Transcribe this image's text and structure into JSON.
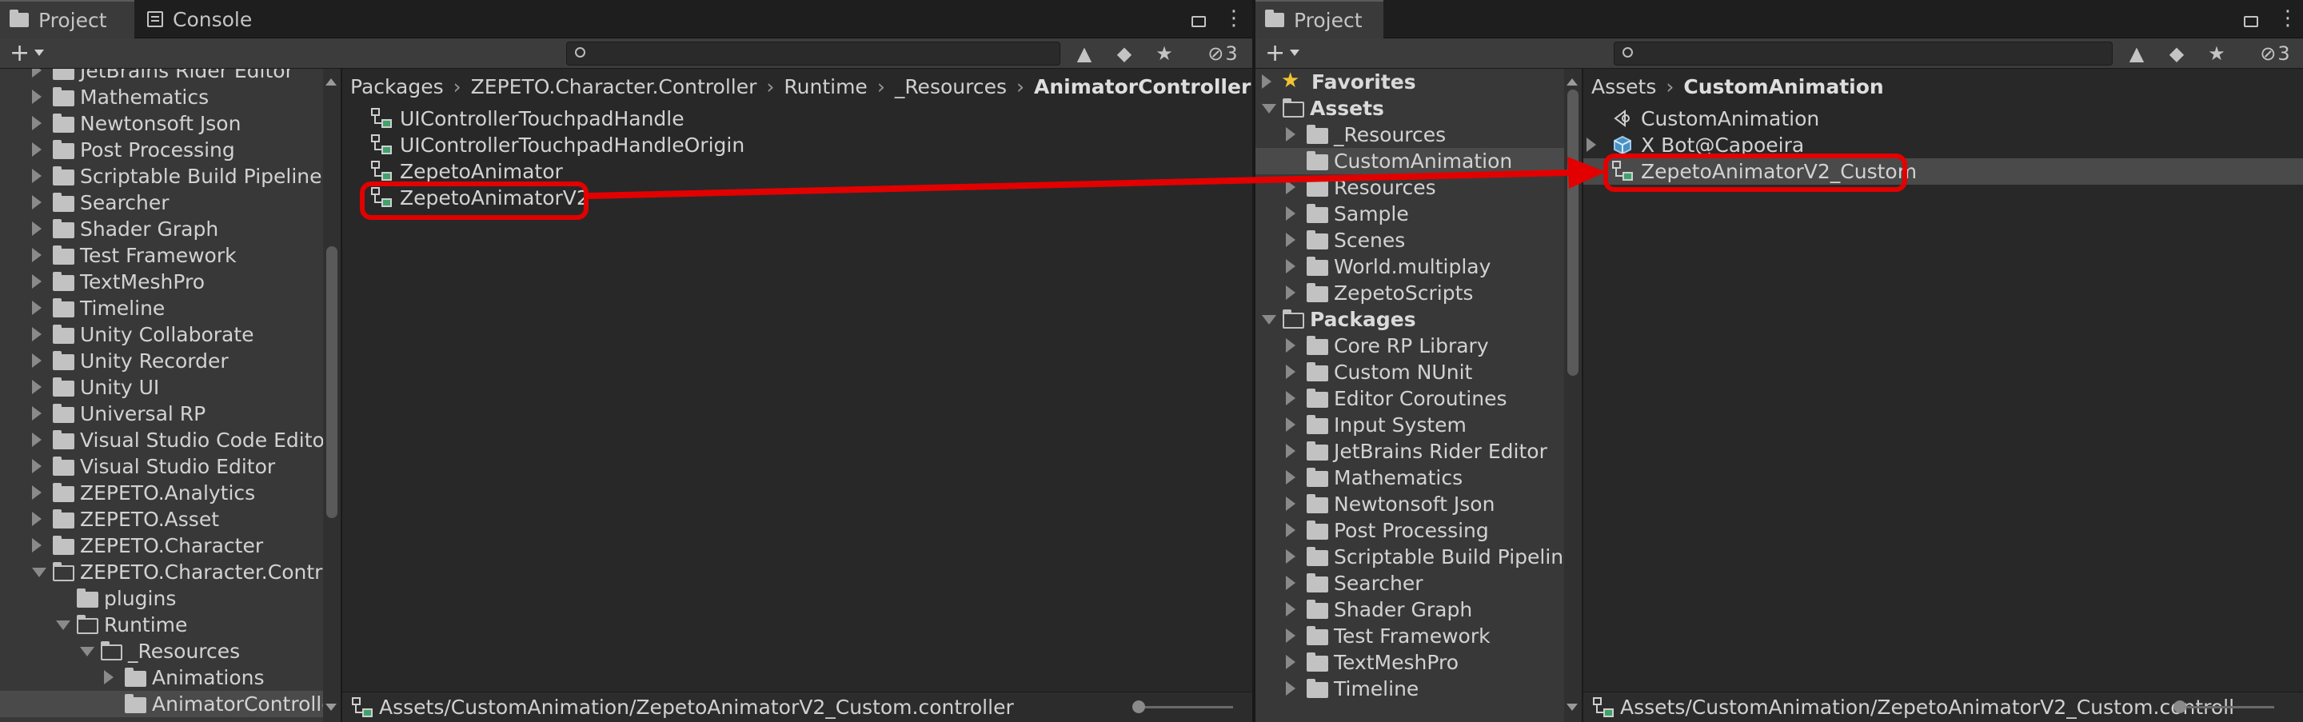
{
  "left_window": {
    "tabs": [
      "Project",
      "Console"
    ],
    "toolbar": {
      "add_label": "+",
      "hidden_count": "3"
    },
    "tree_items": [
      {
        "label": "JetBrains Rider Editor",
        "expanded": false
      },
      {
        "label": "Mathematics",
        "expanded": false
      },
      {
        "label": "Newtonsoft Json",
        "expanded": false
      },
      {
        "label": "Post Processing",
        "expanded": false
      },
      {
        "label": "Scriptable Build Pipeline",
        "expanded": false
      },
      {
        "label": "Searcher",
        "expanded": false
      },
      {
        "label": "Shader Graph",
        "expanded": false
      },
      {
        "label": "Test Framework",
        "expanded": false
      },
      {
        "label": "TextMeshPro",
        "expanded": false
      },
      {
        "label": "Timeline",
        "expanded": false
      },
      {
        "label": "Unity Collaborate",
        "expanded": false
      },
      {
        "label": "Unity Recorder",
        "expanded": false
      },
      {
        "label": "Unity UI",
        "expanded": false
      },
      {
        "label": "Universal RP",
        "expanded": false
      },
      {
        "label": "Visual Studio Code Editor",
        "expanded": false
      },
      {
        "label": "Visual Studio Editor",
        "expanded": false
      },
      {
        "label": "ZEPETO.Analytics",
        "expanded": false
      },
      {
        "label": "ZEPETO.Asset",
        "expanded": false
      },
      {
        "label": "ZEPETO.Character",
        "expanded": false
      },
      {
        "label": "ZEPETO.Character.Contro",
        "expanded": true
      },
      {
        "label": "plugins",
        "expanded": false
      },
      {
        "label": "Runtime",
        "expanded": true
      },
      {
        "label": "_Resources",
        "expanded": true
      },
      {
        "label": "Animations",
        "expanded": false
      },
      {
        "label": "AnimatorController",
        "expanded": false
      }
    ],
    "breadcrumb": [
      "Packages",
      "ZEPETO.Character.Controller",
      "Runtime",
      "_Resources",
      "AnimatorController"
    ],
    "files": [
      "UIControllerTouchpadHandle",
      "UIControllerTouchpadHandleOrigin",
      "ZepetoAnimator",
      "ZepetoAnimatorV2"
    ],
    "status_path": "Assets/CustomAnimation/ZepetoAnimatorV2_Custom.controller"
  },
  "right_window": {
    "tabs": [
      "Project"
    ],
    "toolbar": {
      "add_label": "+",
      "hidden_count": "3"
    },
    "favorites_label": "Favorites",
    "tree_items": [
      {
        "label": "Assets",
        "expanded": true,
        "section": true
      },
      {
        "label": "_Resources",
        "expanded": false
      },
      {
        "label": "CustomAnimation",
        "expanded": false
      },
      {
        "label": "Resources",
        "expanded": false
      },
      {
        "label": "Sample",
        "expanded": false
      },
      {
        "label": "Scenes",
        "expanded": false
      },
      {
        "label": "World.multiplay",
        "expanded": false
      },
      {
        "label": "ZepetoScripts",
        "expanded": false
      },
      {
        "label": "Packages",
        "expanded": true,
        "section": true
      },
      {
        "label": "Core RP Library",
        "expanded": false
      },
      {
        "label": "Custom NUnit",
        "expanded": false
      },
      {
        "label": "Editor Coroutines",
        "expanded": false
      },
      {
        "label": "Input System",
        "expanded": false
      },
      {
        "label": "JetBrains Rider Editor",
        "expanded": false
      },
      {
        "label": "Mathematics",
        "expanded": false
      },
      {
        "label": "Newtonsoft Json",
        "expanded": false
      },
      {
        "label": "Post Processing",
        "expanded": false
      },
      {
        "label": "Scriptable Build Pipeline",
        "expanded": false
      },
      {
        "label": "Searcher",
        "expanded": false
      },
      {
        "label": "Shader Graph",
        "expanded": false
      },
      {
        "label": "Test Framework",
        "expanded": false
      },
      {
        "label": "TextMeshPro",
        "expanded": false
      },
      {
        "label": "Timeline",
        "expanded": false
      }
    ],
    "breadcrumb": [
      "Assets",
      "CustomAnimation"
    ],
    "files": [
      "CustomAnimation",
      "X Bot@Capoeira",
      "ZepetoAnimatorV2_Custom"
    ],
    "status_path": "Assets/CustomAnimation/ZepetoAnimatorV2_Custom.controll"
  },
  "annotation_color": "#e30000"
}
